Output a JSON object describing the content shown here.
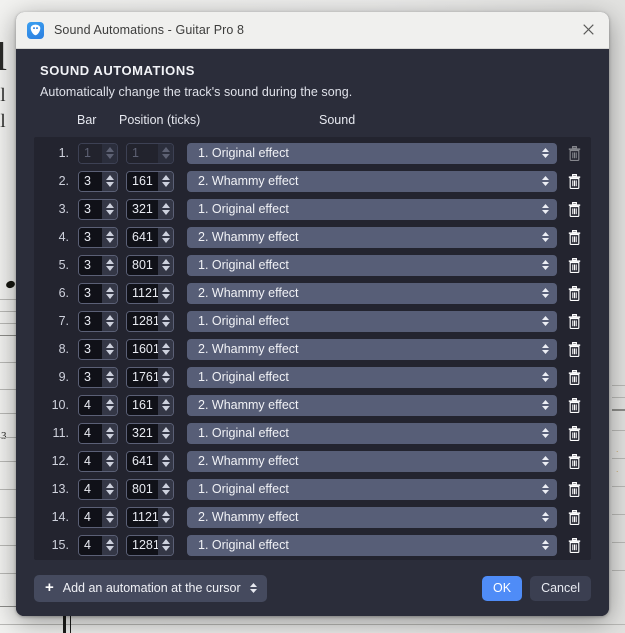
{
  "window": {
    "title": "Sound Automations - Guitar Pro 8",
    "app_icon": "guitar-pick-icon",
    "close_icon": "close-icon"
  },
  "dialog": {
    "heading": "SOUND AUTOMATIONS",
    "subheading": "Automatically change the track's sound during the song.",
    "columns": {
      "index": "",
      "bar": "Bar",
      "position": "Position (ticks)",
      "sound": "Sound"
    },
    "rows": [
      {
        "index": "1.",
        "bar": "1",
        "position": "1",
        "sound": "1. Original effect",
        "disabled": true
      },
      {
        "index": "2.",
        "bar": "3",
        "position": "161",
        "sound": "2. Whammy effect",
        "disabled": false
      },
      {
        "index": "3.",
        "bar": "3",
        "position": "321",
        "sound": "1. Original effect",
        "disabled": false
      },
      {
        "index": "4.",
        "bar": "3",
        "position": "641",
        "sound": "2. Whammy effect",
        "disabled": false
      },
      {
        "index": "5.",
        "bar": "3",
        "position": "801",
        "sound": "1. Original effect",
        "disabled": false
      },
      {
        "index": "6.",
        "bar": "3",
        "position": "1121",
        "sound": "2. Whammy effect",
        "disabled": false
      },
      {
        "index": "7.",
        "bar": "3",
        "position": "1281",
        "sound": "1. Original effect",
        "disabled": false
      },
      {
        "index": "8.",
        "bar": "3",
        "position": "1601",
        "sound": "2. Whammy effect",
        "disabled": false
      },
      {
        "index": "9.",
        "bar": "3",
        "position": "1761",
        "sound": "1. Original effect",
        "disabled": false
      },
      {
        "index": "10.",
        "bar": "4",
        "position": "161",
        "sound": "2. Whammy effect",
        "disabled": false
      },
      {
        "index": "11.",
        "bar": "4",
        "position": "321",
        "sound": "1. Original effect",
        "disabled": false
      },
      {
        "index": "12.",
        "bar": "4",
        "position": "641",
        "sound": "2. Whammy effect",
        "disabled": false
      },
      {
        "index": "13.",
        "bar": "4",
        "position": "801",
        "sound": "1. Original effect",
        "disabled": false
      },
      {
        "index": "14.",
        "bar": "4",
        "position": "1121",
        "sound": "2. Whammy effect",
        "disabled": false
      },
      {
        "index": "15.",
        "bar": "4",
        "position": "1281",
        "sound": "1. Original effect",
        "disabled": false
      }
    ],
    "row_icons": {
      "spinner_up": "triangle-up-icon",
      "spinner_down": "triangle-down-icon",
      "select_chevrons": "chevron-up-down-icon",
      "delete": "trash-icon"
    }
  },
  "footer": {
    "add_label": "Add an automation at the cursor",
    "add_plus_icon": "plus-icon",
    "add_chevrons_icon": "chevron-up-down-icon",
    "ok_label": "OK",
    "cancel_label": "Cancel"
  },
  "colors": {
    "dialog_background": "#2b2d3a",
    "list_background": "#23242f",
    "titlebar_background": "#f0f0ee",
    "select_background": "#575e77",
    "accent_ok": "#4f8cf7",
    "cancel_background": "#3b3f51",
    "spin_field": "#101118"
  },
  "background": {
    "fragments": [
      "l",
      "al",
      "al",
      "3"
    ]
  }
}
